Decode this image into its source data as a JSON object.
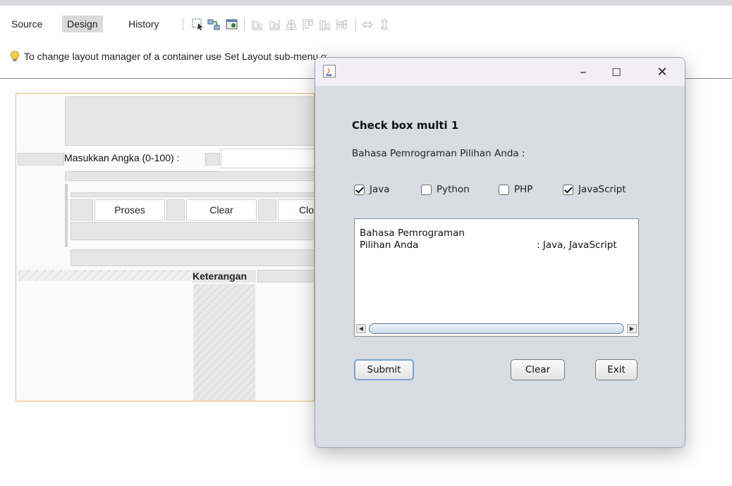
{
  "ide": {
    "tabs": [
      {
        "label": "Source"
      },
      {
        "label": "Design"
      },
      {
        "label": "History"
      }
    ],
    "active_tab": "Design",
    "hint": "To change layout manager of a container use Set Layout sub-menu of container's context menu"
  },
  "design": {
    "label_input": "Masukkan Angka (0-100) :",
    "buttons": {
      "proses": "Proses",
      "clear": "Clear",
      "close": "Clo"
    },
    "column_header": "Keterangan"
  },
  "dialog": {
    "heading": "Check box multi 1",
    "subtitle": "Bahasa Pemrograman Pilihan Anda :",
    "checkboxes": [
      {
        "label": "Java",
        "checked": true
      },
      {
        "label": "Python",
        "checked": false
      },
      {
        "label": "PHP",
        "checked": false
      },
      {
        "label": "JavaScript",
        "checked": true
      }
    ],
    "output": {
      "line1": "Bahasa Pemrograman",
      "line2_label": "Pilihan Anda",
      "line2_value": ": Java, JavaScript"
    },
    "buttons": {
      "submit": "Submit",
      "clear": "Clear",
      "exit": "Exit"
    },
    "window_controls": {
      "minimize": "–",
      "maximize": "☐",
      "close": "✕"
    }
  }
}
